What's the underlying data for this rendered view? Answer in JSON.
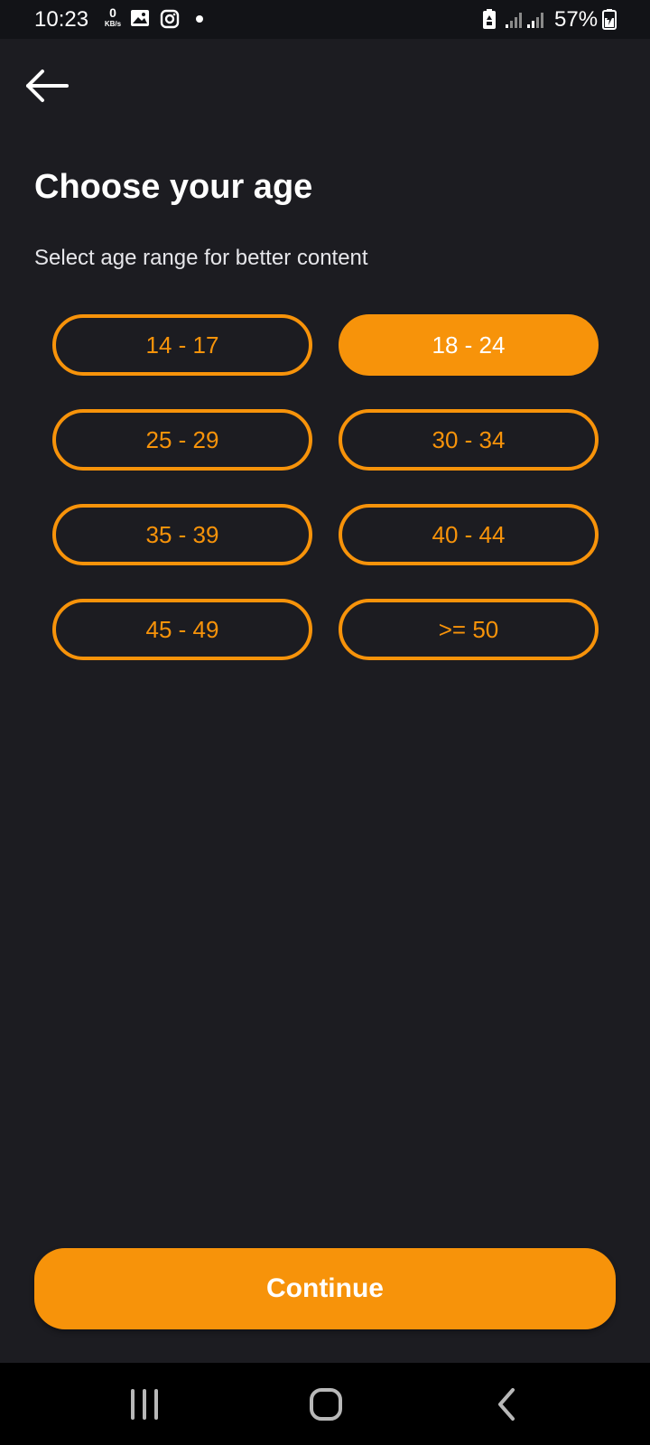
{
  "status_bar": {
    "time": "10:23",
    "net_speed_value": "0",
    "net_speed_unit": "KB/s",
    "battery_percent": "57%",
    "icons": [
      "image-icon",
      "instagram-icon",
      "notification-dot-icon",
      "battery-saver-icon",
      "signal-icon",
      "signal-icon",
      "battery-icon"
    ]
  },
  "header": {
    "back_icon": "arrow-left-icon",
    "title": "Choose your age",
    "subtitle": "Select age range for better content"
  },
  "age_options": [
    {
      "label": "14 - 17",
      "selected": false
    },
    {
      "label": "18 - 24",
      "selected": true
    },
    {
      "label": "25 - 29",
      "selected": false
    },
    {
      "label": "30 - 34",
      "selected": false
    },
    {
      "label": "35 - 39",
      "selected": false
    },
    {
      "label": "40 - 44",
      "selected": false
    },
    {
      "label": "45 - 49",
      "selected": false
    },
    {
      "label": ">= 50",
      "selected": false
    }
  ],
  "footer": {
    "continue_label": "Continue"
  },
  "nav_bar": {
    "icons": [
      "recent-apps-icon",
      "home-icon",
      "back-icon"
    ]
  },
  "colors": {
    "accent": "#f7930a",
    "background": "#1c1c21",
    "status_bar_bg": "#121317",
    "nav_bar_bg": "#000000",
    "text_primary": "#ffffff"
  }
}
